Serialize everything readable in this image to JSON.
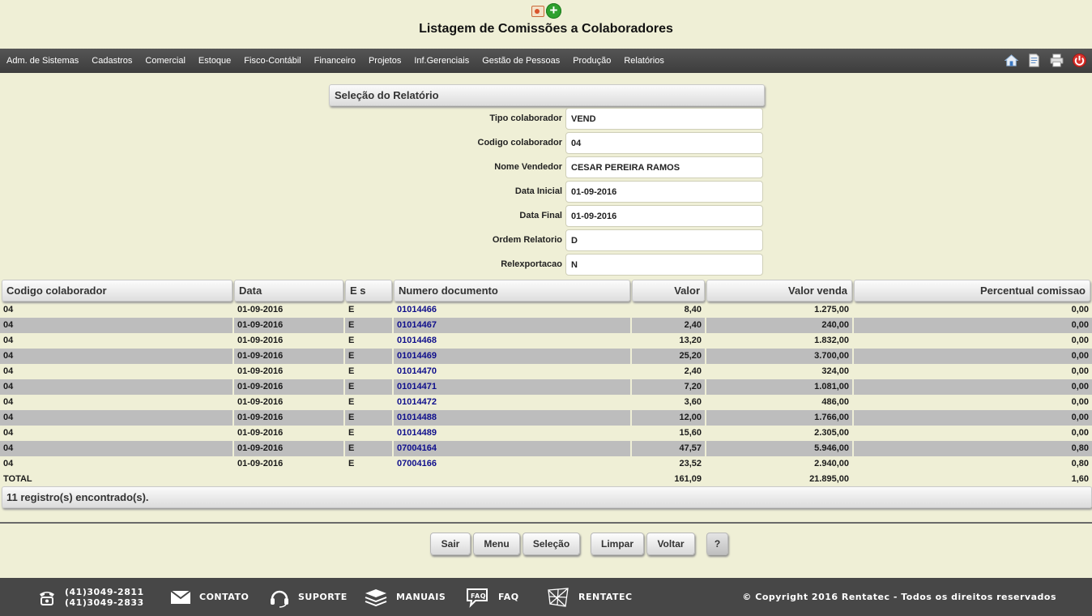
{
  "header": {
    "title": "Listagem de Comissões a Colaboradores",
    "icons": [
      "powerpoint-icon",
      "add-icon"
    ]
  },
  "menu": {
    "items": [
      "Adm. de Sistemas",
      "Cadastros",
      "Comercial",
      "Estoque",
      "Fisco-Contábil",
      "Financeiro",
      "Projetos",
      "Inf.Gerenciais",
      "Gestão de Pessoas",
      "Produção",
      "Relatórios"
    ],
    "right_icons": [
      "home-icon",
      "document-icon",
      "printer-icon",
      "power-icon"
    ]
  },
  "selection": {
    "title": "Seleção do Relatório",
    "fields": [
      {
        "label": "Tipo colaborador",
        "value": "VEND"
      },
      {
        "label": "Codigo colaborador",
        "value": "04"
      },
      {
        "label": "Nome Vendedor",
        "value": "CESAR PEREIRA RAMOS"
      },
      {
        "label": "Data Inicial",
        "value": "01-09-2016"
      },
      {
        "label": "Data Final",
        "value": "01-09-2016"
      },
      {
        "label": "Ordem Relatorio",
        "value": "D"
      },
      {
        "label": "Relexportacao",
        "value": "N"
      }
    ]
  },
  "table": {
    "columns": [
      "Codigo colaborador",
      "Data",
      "E s",
      "Numero documento",
      "Valor",
      "Valor venda",
      "Percentual comissao"
    ],
    "rows": [
      [
        "04",
        "01-09-2016",
        "E",
        "01014466",
        "8,40",
        "1.275,00",
        "0,00"
      ],
      [
        "04",
        "01-09-2016",
        "E",
        "01014467",
        "2,40",
        "240,00",
        "0,00"
      ],
      [
        "04",
        "01-09-2016",
        "E",
        "01014468",
        "13,20",
        "1.832,00",
        "0,00"
      ],
      [
        "04",
        "01-09-2016",
        "E",
        "01014469",
        "25,20",
        "3.700,00",
        "0,00"
      ],
      [
        "04",
        "01-09-2016",
        "E",
        "01014470",
        "2,40",
        "324,00",
        "0,00"
      ],
      [
        "04",
        "01-09-2016",
        "E",
        "01014471",
        "7,20",
        "1.081,00",
        "0,00"
      ],
      [
        "04",
        "01-09-2016",
        "E",
        "01014472",
        "3,60",
        "486,00",
        "0,00"
      ],
      [
        "04",
        "01-09-2016",
        "E",
        "01014488",
        "12,00",
        "1.766,00",
        "0,00"
      ],
      [
        "04",
        "01-09-2016",
        "E",
        "01014489",
        "15,60",
        "2.305,00",
        "0,00"
      ],
      [
        "04",
        "01-09-2016",
        "E",
        "07004164",
        "47,57",
        "5.946,00",
        "0,80"
      ],
      [
        "04",
        "01-09-2016",
        "E",
        "07004166",
        "23,52",
        "2.940,00",
        "0,80"
      ]
    ],
    "total": {
      "label": "TOTAL",
      "valor": "161,09",
      "valor_venda": "21.895,00",
      "percentual": "1,60"
    },
    "status": "11 registro(s) encontrado(s)."
  },
  "buttons": {
    "sair": "Sair",
    "menu": "Menu",
    "selecao": "Seleção",
    "limpar": "Limpar",
    "voltar": "Voltar",
    "help": "?"
  },
  "footer": {
    "phone1": "(41)3049-2811",
    "phone2": "(41)3049-2833",
    "contato": "CONTATO",
    "suporte": "SUPORTE",
    "manuais": "MANUAIS",
    "faq": "FAQ",
    "rentatec": "RENTATEC",
    "copyright": "© Copyright 2016 Rentatec - Todos os direitos reservados"
  },
  "colors": {
    "background": "#efefd6",
    "menubar": "#474747",
    "footer": "#474747",
    "row_alt": "#bdbdbd",
    "link": "#0f0f8c"
  }
}
